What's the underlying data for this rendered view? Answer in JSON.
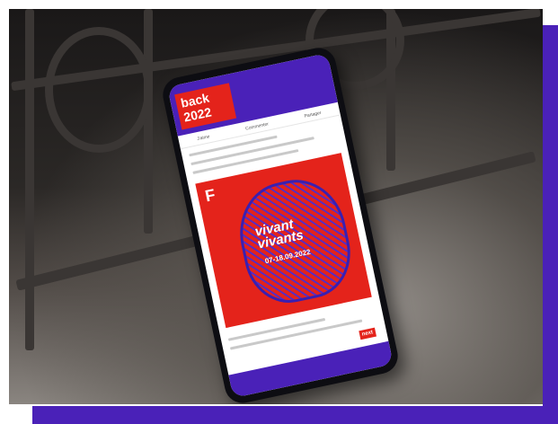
{
  "scene": {
    "description_colors": {
      "accent": "#4a21b8",
      "brand_red": "#e4231b"
    }
  },
  "phone": {
    "header_badge_line1": "back",
    "header_badge_line2": "2022",
    "actions": [
      "J'aime",
      "Commenter",
      "Partager"
    ],
    "post_title_line1": "vivant",
    "post_title_line2": "vivants",
    "post_dates": "07-18.09.2022",
    "post_logo": "F",
    "next_label": "next"
  }
}
